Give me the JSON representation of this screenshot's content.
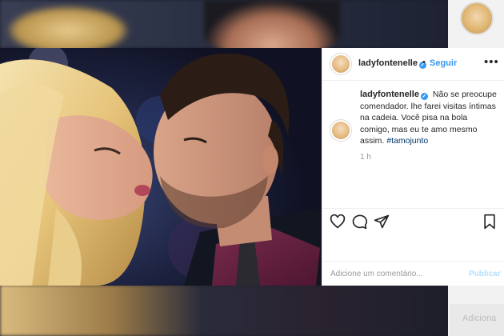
{
  "post": {
    "username": "ladyfontenelle",
    "verified": true,
    "follow_label": "Seguir",
    "separator": "•",
    "more_label": "•••",
    "caption": "Não se preocupe comendador. lhe farei visitas íntimas na cadeia. Você pisa na bola comigo, mas eu te amo mesmo assim.",
    "hashtag": "#tamojunto",
    "time_ago": "1 h"
  },
  "actions": {
    "like_icon": "heart-icon",
    "comment_icon": "comment-icon",
    "share_icon": "share-icon",
    "save_icon": "bookmark-icon"
  },
  "comment": {
    "placeholder": "Adicione um comentário...",
    "publish_label": "Publicar"
  },
  "background": {
    "side_text": "Adiciona"
  },
  "colors": {
    "accent": "#3897f0",
    "publish_disabled": "#b2dffc",
    "hashtag": "#003569"
  }
}
